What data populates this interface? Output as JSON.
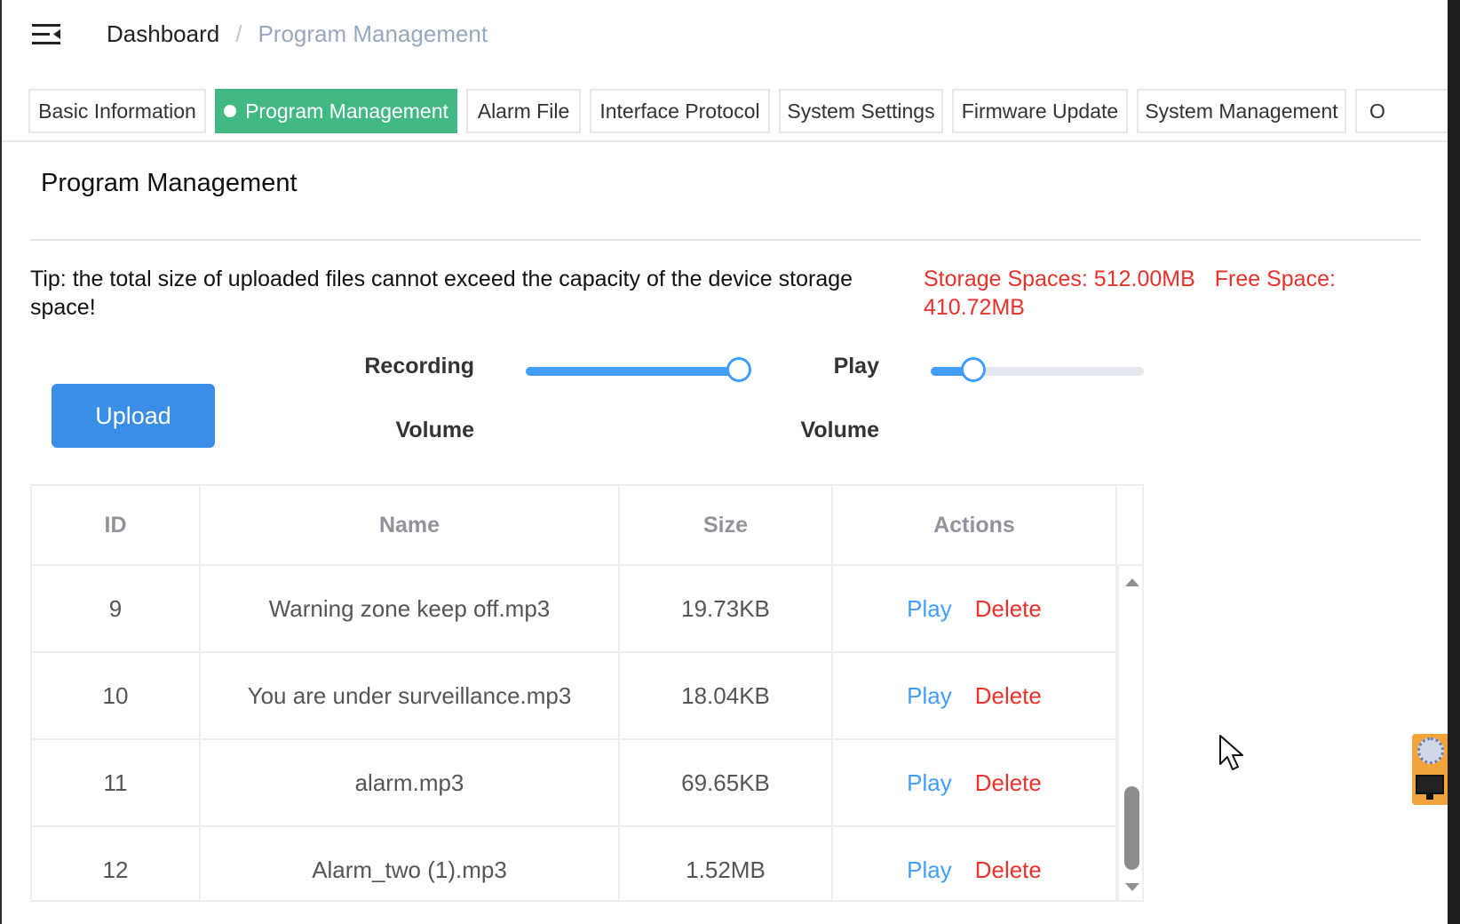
{
  "breadcrumb": {
    "home": "Dashboard",
    "separator": "/",
    "current": "Program Management"
  },
  "tabs": [
    {
      "label": "Basic Information"
    },
    {
      "label": "Program Management",
      "active": true
    },
    {
      "label": "Alarm File"
    },
    {
      "label": "Interface Protocol"
    },
    {
      "label": "System Settings"
    },
    {
      "label": "Firmware Update"
    },
    {
      "label": "System Management"
    },
    {
      "label": "O"
    }
  ],
  "page": {
    "title": "Program Management",
    "tip": "Tip: the total size of uploaded files cannot exceed the capacity of the device storage space!",
    "storage_label": "Storage Spaces: 512.00MB",
    "free_label": "Free Space: 410.72MB"
  },
  "upload": {
    "label": "Upload"
  },
  "volume": {
    "recording": {
      "label_line1": "Recording",
      "label_line2": "Volume",
      "level": 100
    },
    "play": {
      "label_line1": "Play",
      "label_line2": "Volume",
      "level": 20
    }
  },
  "table": {
    "columns": [
      "ID",
      "Name",
      "Size",
      "Actions"
    ],
    "rows": [
      {
        "id": "9",
        "name": "Warning zone keep off.mp3",
        "size": "19.73KB",
        "play": "Play",
        "delete": "Delete"
      },
      {
        "id": "10",
        "name": "You are under surveillance.mp3",
        "size": "18.04KB",
        "play": "Play",
        "delete": "Delete"
      },
      {
        "id": "11",
        "name": "alarm.mp3",
        "size": "69.65KB",
        "play": "Play",
        "delete": "Delete"
      },
      {
        "id": "12",
        "name": "Alarm_two (1).mp3",
        "size": "1.52MB",
        "play": "Play",
        "delete": "Delete"
      }
    ]
  },
  "colors": {
    "accent": "#42b983",
    "primary": "#409eff",
    "danger": "#e8322b"
  }
}
